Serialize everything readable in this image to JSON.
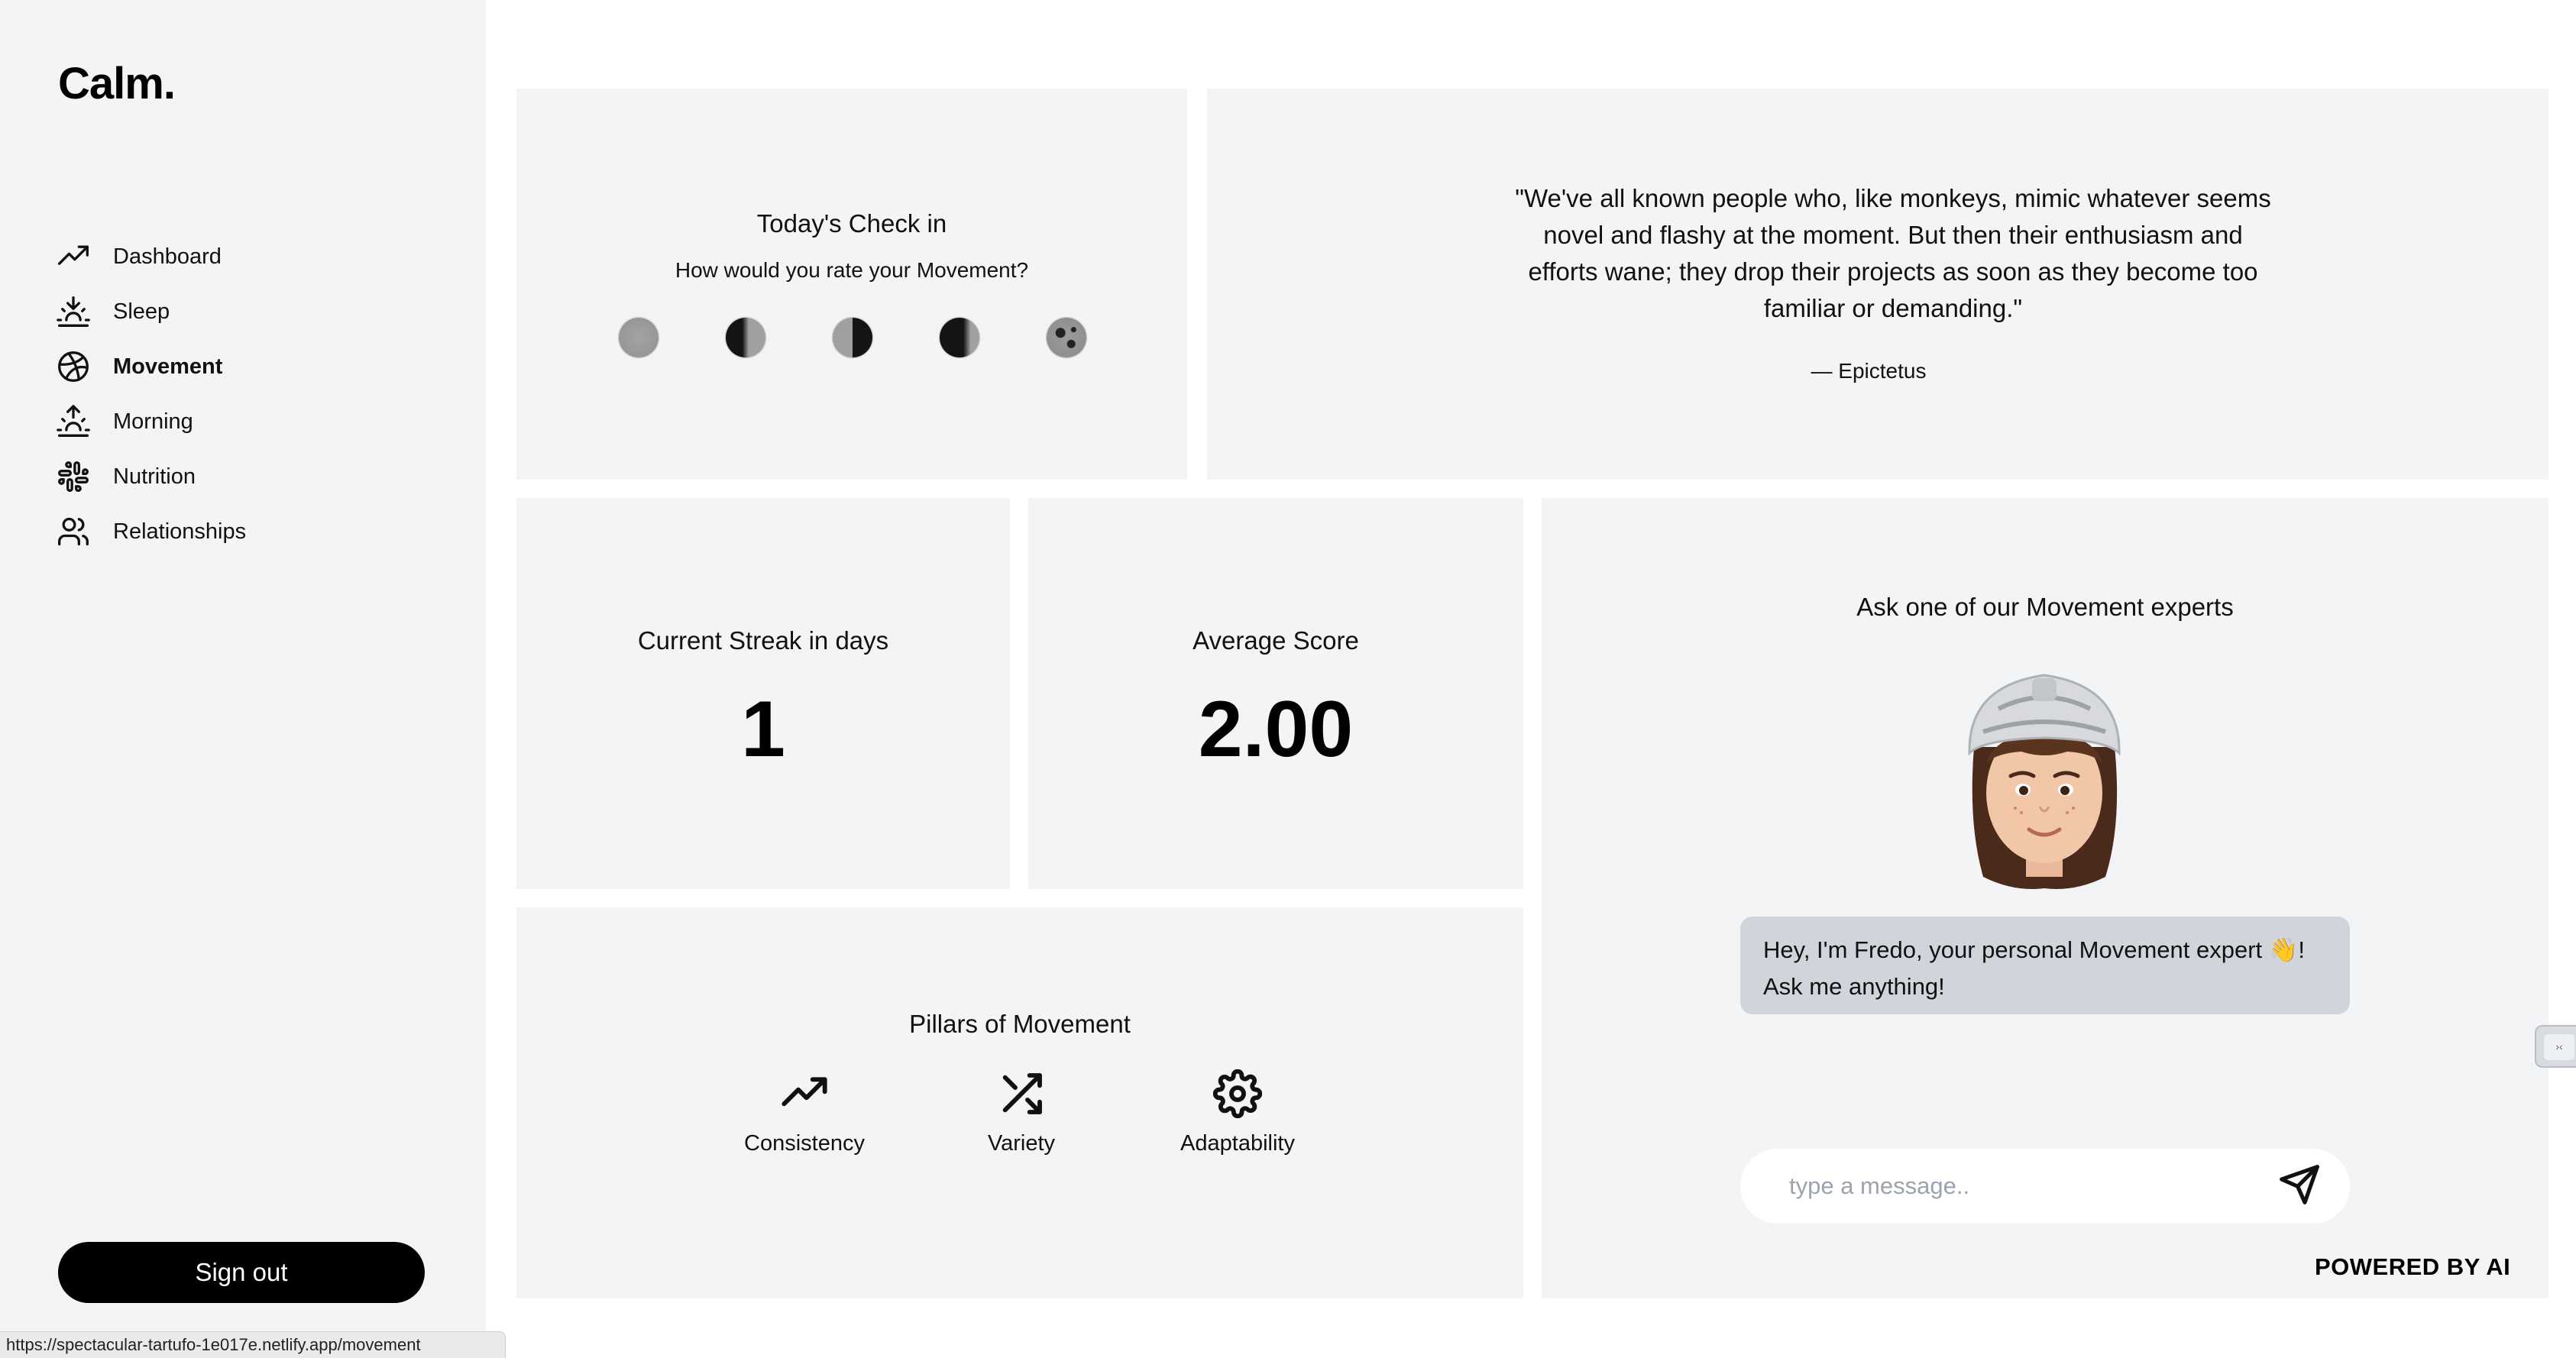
{
  "app": {
    "logo": "Calm."
  },
  "sidebar": {
    "items": [
      {
        "label": "Dashboard",
        "icon": "trending-up-icon",
        "active": false
      },
      {
        "label": "Sleep",
        "icon": "sunset-icon",
        "active": false
      },
      {
        "label": "Movement",
        "icon": "dribbble-ball-icon",
        "active": true
      },
      {
        "label": "Morning",
        "icon": "sunrise-icon",
        "active": false
      },
      {
        "label": "Nutrition",
        "icon": "slack-grid-icon",
        "active": false
      },
      {
        "label": "Relationships",
        "icon": "users-icon",
        "active": false
      }
    ],
    "signout_label": "Sign out"
  },
  "checkin": {
    "title": "Today's Check in",
    "question": "How would you rate your Movement?",
    "options": [
      {
        "icon": "full-moon-grey-icon"
      },
      {
        "icon": "waning-crescent-icon"
      },
      {
        "icon": "half-moon-icon"
      },
      {
        "icon": "waxing-crescent-icon"
      },
      {
        "icon": "new-moon-crater-icon"
      }
    ]
  },
  "quote": {
    "text": "\"We've all known people who, like monkeys, mimic whatever seems novel and flashy at the moment. But then their enthusiasm and efforts wane; they drop their projects as soon as they become too familiar or demanding.\"",
    "author": "— Epictetus"
  },
  "stats": {
    "streak_label": "Current Streak in days",
    "streak_value": "1",
    "average_label": "Average Score",
    "average_value": "2.00"
  },
  "pillars": {
    "title": "Pillars of Movement",
    "items": [
      {
        "label": "Consistency",
        "icon": "trending-up-icon"
      },
      {
        "label": "Variety",
        "icon": "shuffle-icon"
      },
      {
        "label": "Adaptability",
        "icon": "gear-icon"
      }
    ]
  },
  "expert": {
    "title": "Ask one of our Movement experts",
    "avatar": "cyclist-memoji-avatar",
    "greeting": "Hey, I'm Fredo, your personal Movement expert 👋! Ask me anything!",
    "input_placeholder": "type a message..",
    "send_icon": "send-icon",
    "powered_by": "POWERED BY AI"
  },
  "status_url": "https://spectacular-tartufo-1e017e.netlify.app/movement",
  "colors": {
    "sidebar_bg": "#f3f4f6",
    "card_bg": "#f3f4f6",
    "bubble_bg": "#d1d5db",
    "button_bg": "#000000",
    "moon_grey": "#9e9e9e"
  }
}
